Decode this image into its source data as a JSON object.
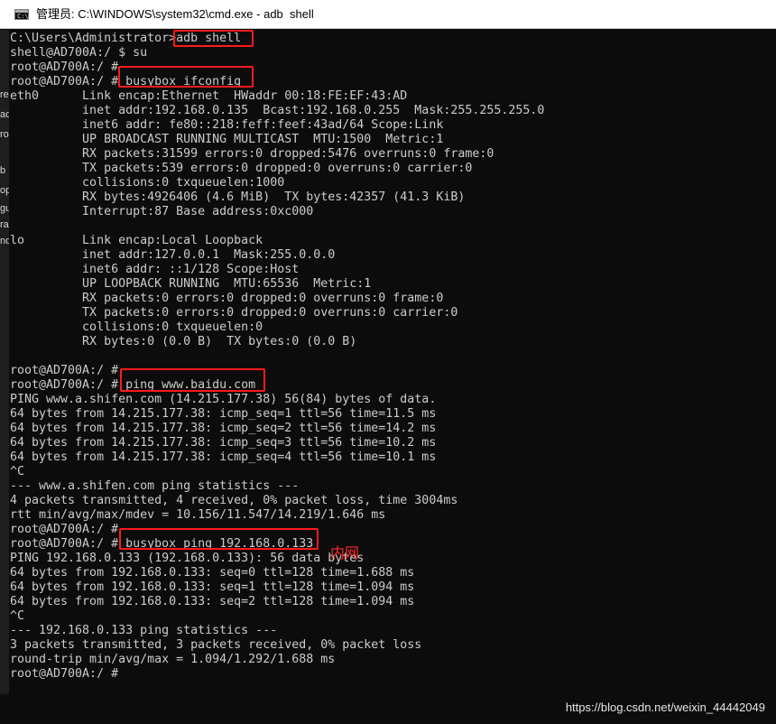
{
  "window": {
    "title": "管理员: C:\\WINDOWS\\system32\\cmd.exe - adb  shell"
  },
  "sidebar_fragments": [
    "re",
    "ad",
    "ro",
    "b",
    "op",
    "gu",
    "ra",
    "nd"
  ],
  "terminal": {
    "lines": [
      "C:\\Users\\Administrator>adb shell",
      "shell@AD700A:/ $ su",
      "root@AD700A:/ #",
      "root@AD700A:/ # busybox ifconfig",
      "eth0      Link encap:Ethernet  HWaddr 00:18:FE:EF:43:AD",
      "          inet addr:192.168.0.135  Bcast:192.168.0.255  Mask:255.255.255.0",
      "          inet6 addr: fe80::218:feff:feef:43ad/64 Scope:Link",
      "          UP BROADCAST RUNNING MULTICAST  MTU:1500  Metric:1",
      "          RX packets:31599 errors:0 dropped:5476 overruns:0 frame:0",
      "          TX packets:539 errors:0 dropped:0 overruns:0 carrier:0",
      "          collisions:0 txqueuelen:1000",
      "          RX bytes:4926406 (4.6 MiB)  TX bytes:42357 (41.3 KiB)",
      "          Interrupt:87 Base address:0xc000",
      "",
      "lo        Link encap:Local Loopback",
      "          inet addr:127.0.0.1  Mask:255.0.0.0",
      "          inet6 addr: ::1/128 Scope:Host",
      "          UP LOOPBACK RUNNING  MTU:65536  Metric:1",
      "          RX packets:0 errors:0 dropped:0 overruns:0 frame:0",
      "          TX packets:0 errors:0 dropped:0 overruns:0 carrier:0",
      "          collisions:0 txqueuelen:0",
      "          RX bytes:0 (0.0 B)  TX bytes:0 (0.0 B)",
      "",
      "root@AD700A:/ #",
      "root@AD700A:/ # ping www.baidu.com",
      "PING www.a.shifen.com (14.215.177.38) 56(84) bytes of data.",
      "64 bytes from 14.215.177.38: icmp_seq=1 ttl=56 time=11.5 ms",
      "64 bytes from 14.215.177.38: icmp_seq=2 ttl=56 time=14.2 ms",
      "64 bytes from 14.215.177.38: icmp_seq=3 ttl=56 time=10.2 ms",
      "64 bytes from 14.215.177.38: icmp_seq=4 ttl=56 time=10.1 ms",
      "^C",
      "--- www.a.shifen.com ping statistics ---",
      "4 packets transmitted, 4 received, 0% packet loss, time 3004ms",
      "rtt min/avg/max/mdev = 10.156/11.547/14.219/1.646 ms",
      "root@AD700A:/ #",
      "root@AD700A:/ # busybox ping 192.168.0.133",
      "PING 192.168.0.133 (192.168.0.133): 56 data bytes",
      "64 bytes from 192.168.0.133: seq=0 ttl=128 time=1.688 ms",
      "64 bytes from 192.168.0.133: seq=1 ttl=128 time=1.094 ms",
      "64 bytes from 192.168.0.133: seq=2 ttl=128 time=1.094 ms",
      "^C",
      "--- 192.168.0.133 ping statistics ---",
      "3 packets transmitted, 3 packets received, 0% packet loss",
      "round-trip min/avg/max = 1.094/1.292/1.688 ms",
      "root@AD700A:/ #"
    ]
  },
  "annotation": {
    "label": "内网",
    "color": "#ff2a2a"
  },
  "watermark": "https://blog.csdn.net/weixin_44442049",
  "colors": {
    "terminal_bg": "#0c0c0c",
    "terminal_fg": "#cccccc",
    "highlight_box": "#ff1a1a"
  }
}
